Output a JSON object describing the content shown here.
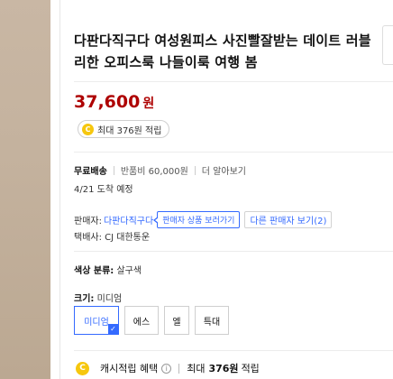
{
  "product": {
    "title": "다판다직구다 여성원피스 사진빨잘받는 데이트 러블리한 오피스룩 나들이룩 여행 봄",
    "price": "37,600",
    "currency": "원",
    "reward_coin": "C",
    "reward_text": "최대 376원 적립"
  },
  "shipping": {
    "label": "무료배송",
    "return_fee": "반품비 60,000원",
    "more": "더 알아보기",
    "arrival": "4/21 도착 예정"
  },
  "seller": {
    "label": "판매자:",
    "name": "다판다직구다",
    "tooltip": "판매자 상품 보러가기",
    "other_sellers": "다른 판매자 보기(2)",
    "courier": "택배사: CJ 대한통운"
  },
  "options": {
    "color_label": "색상 분류:",
    "color_value": "살구색",
    "size_label": "크기:",
    "size_value": "미디엄",
    "sizes": [
      "미디엄",
      "에스",
      "엘",
      "특대"
    ],
    "selected_index": 0,
    "check_mark": "✓"
  },
  "cash": {
    "coin": "C",
    "label": "캐시적립 혜택",
    "info_icon": "i",
    "max_prefix": "최대",
    "amount": "376원",
    "suffix": "적립"
  },
  "colors": {
    "price": "#ae0000",
    "link": "#346aff",
    "coin": "#f6c70e"
  }
}
